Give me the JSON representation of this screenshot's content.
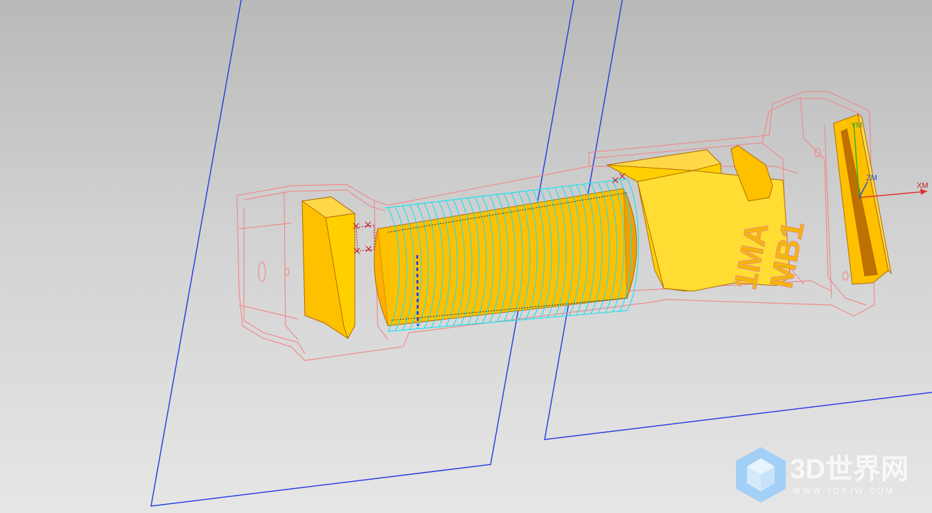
{
  "axes": {
    "x_label": "XM",
    "y_label": "YM",
    "z_label": "ZM"
  },
  "part_marking": {
    "line1": "1MA",
    "line2": "MB1"
  },
  "watermark": {
    "title": "3D世界网",
    "url": "WWW.3DSJW.COM"
  },
  "colors": {
    "background": "#c8c8c8",
    "datum_plane": "#2a3fe0",
    "solid_part": "#ffc000",
    "wireframe": "#f08a8a",
    "toolpath": "#22e0ee",
    "axis_x": "#e03030",
    "axis_y": "#30b030",
    "axis_z": "#2050e0"
  }
}
